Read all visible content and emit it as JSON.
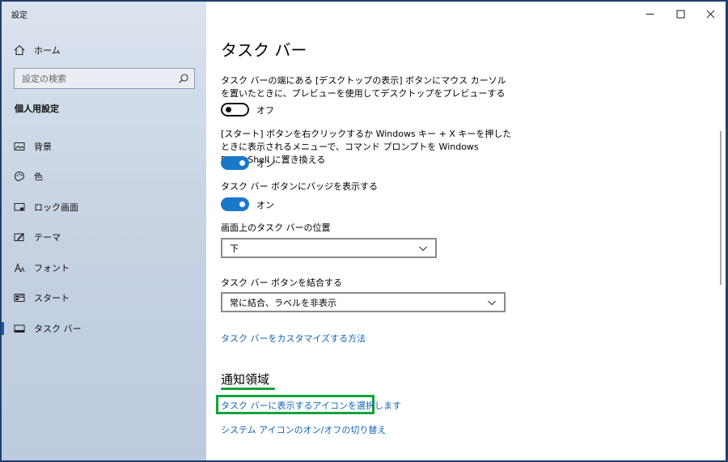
{
  "window": {
    "title": "設定",
    "minimize_icon": "minimize-icon",
    "maximize_icon": "maximize-icon",
    "close_icon": "close-icon"
  },
  "sidebar": {
    "home_label": "ホーム",
    "search_placeholder": "設定の検索",
    "section_heading": "個人用設定",
    "items": [
      {
        "label": "背景",
        "icon": "picture-icon"
      },
      {
        "label": "色",
        "icon": "palette-icon"
      },
      {
        "label": "ロック画面",
        "icon": "lock-screen-icon"
      },
      {
        "label": "テーマ",
        "icon": "theme-icon"
      },
      {
        "label": "フォント",
        "icon": "font-icon"
      },
      {
        "label": "スタート",
        "icon": "start-icon"
      },
      {
        "label": "タスク バー",
        "icon": "taskbar-icon",
        "active": true
      }
    ]
  },
  "main": {
    "title": "タスク バー",
    "settings": {
      "peek": {
        "description": "タスク バーの端にある [デスクトップの表示] ボタンにマウス カーソルを置いたときに、プレビューを使用してデスクトップをプレビューする",
        "state_label": "オフ",
        "enabled": false
      },
      "powershell": {
        "description": "[スタート] ボタンを右クリックするか Windows キー + X キーを押したときに表示されるメニューで、コマンド プロンプトを Windows PowerShell に置き換える",
        "state_label": "オン",
        "enabled": true
      },
      "badges": {
        "description": "タスク バー ボタンにバッジを表示する",
        "state_label": "オン",
        "enabled": true
      },
      "position": {
        "label": "画面上のタスク バーの位置",
        "value": "下"
      },
      "combine": {
        "label": "タスク バー ボタンを結合する",
        "value": "常に結合、ラベルを非表示"
      }
    },
    "customize_link": "タスク バーをカスタマイズする方法",
    "notification_area": {
      "heading": "通知領域",
      "select_icons_link": "タスク バーに表示するアイコンを選択します",
      "system_icons_link": "システム アイコンのオン/オフの切り替え"
    }
  },
  "colors": {
    "accent": "#1a78c8",
    "link": "#0f64b8",
    "highlight": "#14a33c"
  }
}
